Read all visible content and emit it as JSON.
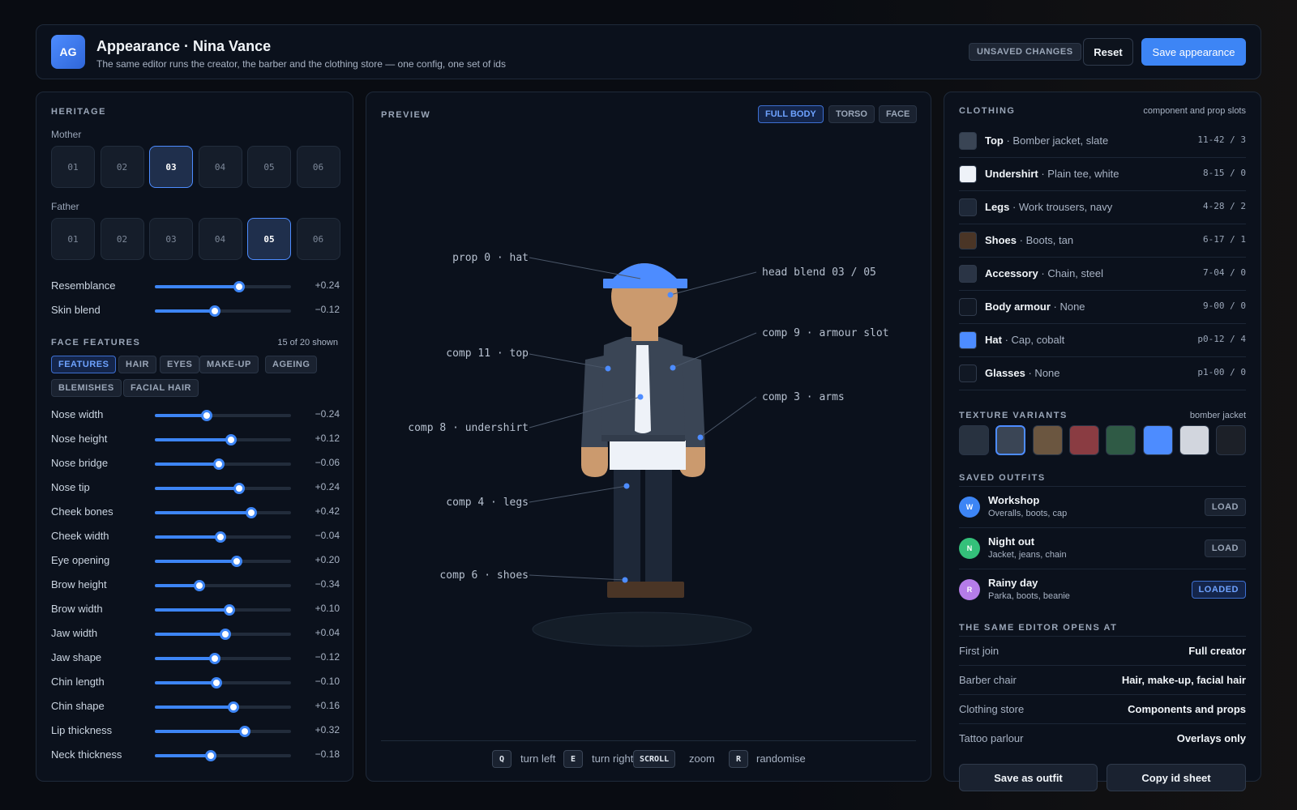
{
  "header": {
    "logo": "AG",
    "title": "Appearance · Nina Vance",
    "subtitle": "The same editor runs the creator, the barber and the clothing store — one config, one set of ids",
    "unsaved_badge": "UNSAVED CHANGES",
    "reset_label": "Reset",
    "save_label": "Save appearance"
  },
  "heritage": {
    "section_label": "HERITAGE",
    "mother_label": "Mother",
    "father_label": "Father",
    "mother_options": [
      "01",
      "02",
      "03",
      "04",
      "05",
      "06"
    ],
    "mother_selected": "03",
    "father_options": [
      "01",
      "02",
      "03",
      "04",
      "05",
      "06"
    ],
    "father_selected": "05",
    "sliders": [
      {
        "label": "Resemblance",
        "value": "+0.24",
        "level": 0.62
      },
      {
        "label": "Skin blend",
        "value": "−0.12",
        "level": 0.44
      }
    ]
  },
  "face": {
    "section_label": "FACE FEATURES",
    "count_text": "15 of 20 shown",
    "tabs": [
      "FEATURES",
      "HAIR",
      "EYES",
      "MAKE-UP",
      "AGEING",
      "BLEMISHES",
      "FACIAL HAIR"
    ],
    "active_tab": "FEATURES",
    "sliders": [
      {
        "label": "Nose width",
        "value": "−0.24",
        "level": 0.38
      },
      {
        "label": "Nose height",
        "value": "+0.12",
        "level": 0.56
      },
      {
        "label": "Nose bridge",
        "value": "−0.06",
        "level": 0.47
      },
      {
        "label": "Nose tip",
        "value": "+0.24",
        "level": 0.62
      },
      {
        "label": "Cheek bones",
        "value": "+0.42",
        "level": 0.71
      },
      {
        "label": "Cheek width",
        "value": "−0.04",
        "level": 0.48
      },
      {
        "label": "Eye opening",
        "value": "+0.20",
        "level": 0.6
      },
      {
        "label": "Brow height",
        "value": "−0.34",
        "level": 0.33
      },
      {
        "label": "Brow width",
        "value": "+0.10",
        "level": 0.55
      },
      {
        "label": "Jaw width",
        "value": "+0.04",
        "level": 0.52
      },
      {
        "label": "Jaw shape",
        "value": "−0.12",
        "level": 0.44
      },
      {
        "label": "Chin length",
        "value": "−0.10",
        "level": 0.45
      },
      {
        "label": "Chin shape",
        "value": "+0.16",
        "level": 0.58
      },
      {
        "label": "Lip thickness",
        "value": "+0.32",
        "level": 0.66
      },
      {
        "label": "Neck thickness",
        "value": "−0.18",
        "level": 0.41
      }
    ]
  },
  "preview": {
    "section_label": "PREVIEW",
    "view_tabs": [
      "FULL BODY",
      "TORSO",
      "FACE"
    ],
    "active_view": "FULL BODY",
    "callouts": {
      "hat": "prop 0 · hat",
      "head": "head blend 03 / 05",
      "top": "comp 11 · top",
      "armour": "comp 9 · armour slot",
      "arms": "comp 3 · arms",
      "undershirt": "comp 8 · undershirt",
      "legs": "comp 4 · legs",
      "shoes": "comp 6 · shoes"
    },
    "controls": [
      {
        "key": "Q",
        "label": "turn left"
      },
      {
        "key": "E",
        "label": "turn right"
      },
      {
        "key": "SCROLL",
        "label": "zoom"
      },
      {
        "key": "R",
        "label": "randomise"
      }
    ]
  },
  "clothing": {
    "section_label": "CLOTHING",
    "note": "component and prop slots",
    "items": [
      {
        "name": "Top",
        "desc": " · Bomber jacket, slate",
        "id": "11-42 / 3",
        "color": "#3a4555"
      },
      {
        "name": "Undershirt",
        "desc": " · Plain tee, white",
        "id": "8-15 / 0",
        "color": "#eef2f8"
      },
      {
        "name": "Legs",
        "desc": " · Work trousers, navy",
        "id": "4-28 / 2",
        "color": "#1e2838"
      },
      {
        "name": "Shoes",
        "desc": " · Boots, tan",
        "id": "6-17 / 1",
        "color": "#4a3526"
      },
      {
        "name": "Accessory",
        "desc": " · Chain, steel",
        "id": "7-04 / 0",
        "color": "#2a3445"
      },
      {
        "name": "Body armour",
        "desc": " · None",
        "id": "9-00 / 0",
        "color": "#111824"
      },
      {
        "name": "Hat",
        "desc": " · Cap, cobalt",
        "id": "p0-12 / 4",
        "color": "#4d8cff"
      },
      {
        "name": "Glasses",
        "desc": " · None",
        "id": "p1-00 / 0",
        "color": "#111824"
      }
    ]
  },
  "textures": {
    "section_label": "TEXTURE VARIANTS",
    "note": "bomber jacket",
    "swatches": [
      "#283240",
      "#3a4555",
      "#6b5640",
      "#8a3c42",
      "#2f5a45",
      "#4d8cff",
      "#d2d6de",
      "#1c2028"
    ],
    "selected_index": 1
  },
  "outfits": {
    "section_label": "SAVED OUTFITS",
    "items": [
      {
        "initial": "W",
        "name": "Workshop",
        "desc": "Overalls, boots, cap",
        "action": "LOAD",
        "color": "#3d85f5"
      },
      {
        "initial": "N",
        "name": "Night out",
        "desc": "Jacket, jeans, chain",
        "action": "LOAD",
        "color": "#34c07a"
      },
      {
        "initial": "R",
        "name": "Rainy day",
        "desc": "Parka, boots, beanie",
        "action": "LOADED",
        "color": "#b57ce8"
      }
    ]
  },
  "opens_at": {
    "section_label": "THE SAME EDITOR OPENS AT",
    "rows": [
      {
        "context": "First join",
        "mode": "Full creator"
      },
      {
        "context": "Barber chair",
        "mode": "Hair, make-up, facial hair"
      },
      {
        "context": "Clothing store",
        "mode": "Components and props"
      },
      {
        "context": "Tattoo parlour",
        "mode": "Overlays only"
      }
    ]
  },
  "footer": {
    "save_outfit_label": "Save as outfit",
    "copy_sheet_label": "Copy id sheet"
  }
}
